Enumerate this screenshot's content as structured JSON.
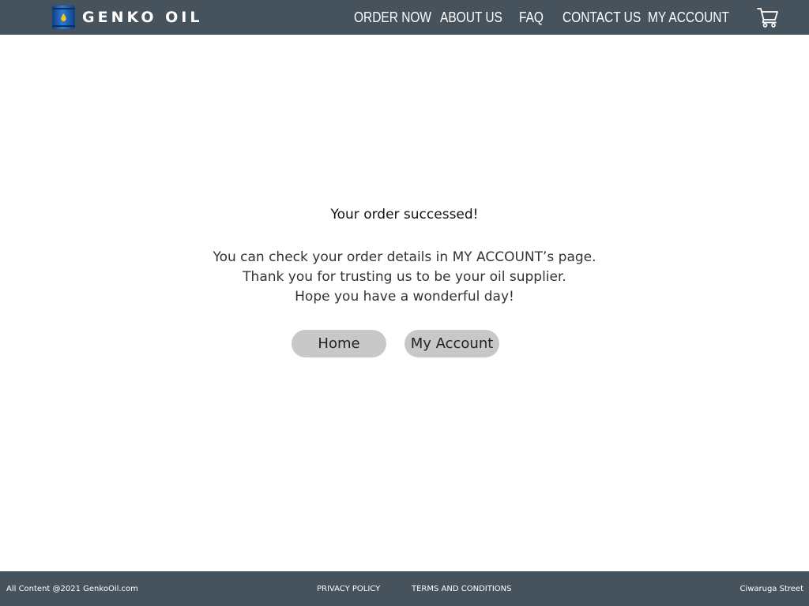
{
  "brand": {
    "name": "GENKO OIL",
    "logo_icon": "oil-barrel-icon",
    "colors": {
      "nav_background": "#46535d",
      "barrel_blue": "#1e5fb0",
      "drop_yellow": "#f5c518",
      "button_background": "#c8c8c8"
    }
  },
  "nav": {
    "order_now": "ORDER NOW",
    "about_us": "ABOUT US",
    "faq": "FAQ",
    "contact_us": "CONTACT US",
    "my_account": "MY ACCOUNT",
    "cart_icon": "shopping-cart-icon"
  },
  "main": {
    "title": "Your order successed!",
    "message_lines": [
      "You can check your order details in MY ACCOUNT’s page.",
      "Thank you for trusting us to be your oil supplier.",
      "Hope you have a wonderful day!"
    ],
    "buttons": {
      "home": "Home",
      "my_account": "My Account"
    }
  },
  "footer": {
    "copyright": "All Content @2021 GenkoOil.com",
    "privacy_policy": "PRIVACY POLICY",
    "terms": "TERMS AND CONDITIONS",
    "address": "Ciwaruga Street"
  }
}
